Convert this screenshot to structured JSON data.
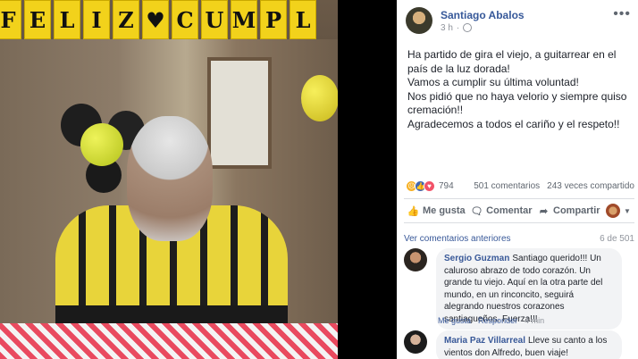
{
  "banner": {
    "letters": [
      "F",
      "E",
      "L",
      "I",
      "Z",
      "♥",
      "C",
      "U",
      "M",
      "P",
      "L"
    ]
  },
  "post": {
    "author": "Santiago Abalos",
    "time": "3 h",
    "more": "•••",
    "lines": [
      "Ha partido de gira el viejo, a guitarrear en el país de la luz dorada!",
      "Vamos a cumplir su última voluntad!",
      "Nos pidió que no haya velorio y siempre quiso cremación!!",
      "Agradecemos a todos el cariño y el respeto!!"
    ],
    "reaction_count": "794",
    "comments_count": "501 comentarios",
    "shares_count": "243 veces compartido",
    "actions": {
      "like": "Me gusta",
      "comment": "Comentar",
      "share": "Compartir"
    }
  },
  "comments_section": {
    "view_previous": "Ver comentarios anteriores",
    "position": "6 de 501",
    "comments": [
      {
        "name": "Sergio Guzman",
        "text": "Santiago querido!!! Un caluroso abrazo de todo corazón. Un grande tu viejo. Aquí en la otra parte del mundo, en un rinconcito, seguirá alegrando nuestros corazones santiagueños. Fuerza!!!",
        "like": "Me gusta",
        "reply": "Responder",
        "time": "4 min"
      },
      {
        "name": "Maria Paz Villarreal",
        "text": "Lleve su canto a los vientos don Alfredo, buen viaje!"
      }
    ]
  },
  "colors": {
    "link": "#385898",
    "author": "#365899",
    "muted": "#90949c",
    "banner": "#f2d21b"
  }
}
